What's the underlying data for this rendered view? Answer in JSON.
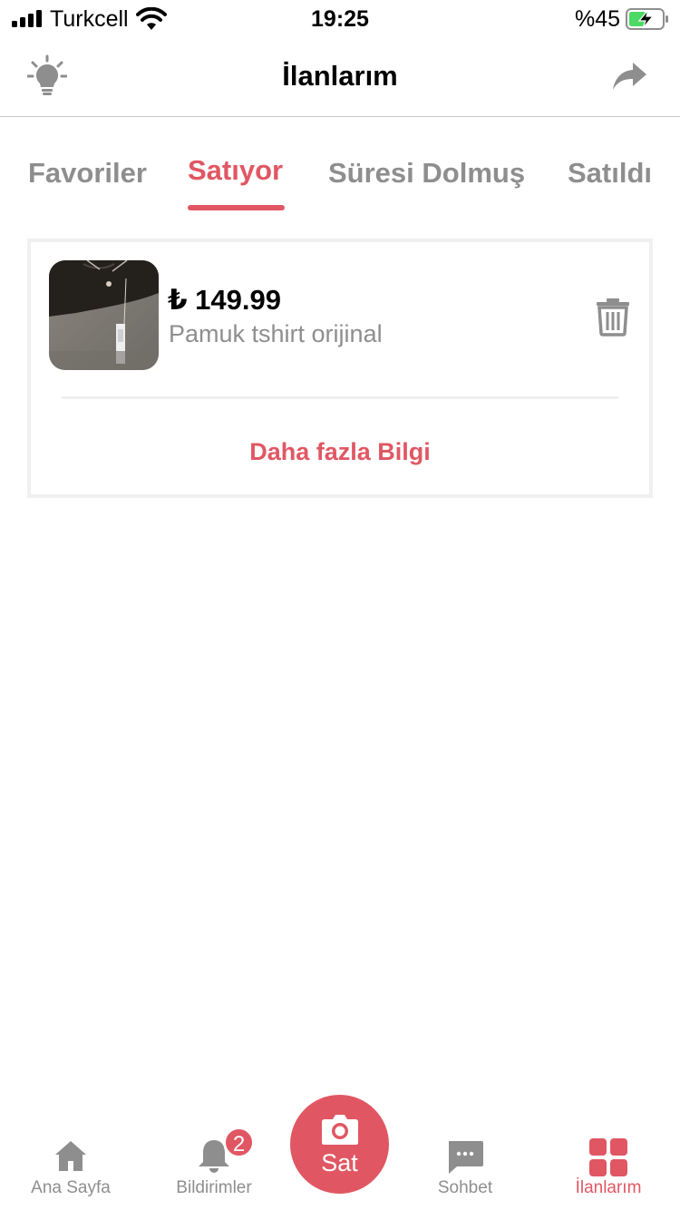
{
  "status_bar": {
    "carrier": "Turkcell",
    "time": "19:25",
    "battery_percent": "%45",
    "battery_level": 0.45
  },
  "header": {
    "title": "İlanlarım",
    "left_icon": "lightbulb-icon",
    "right_icon": "share-icon"
  },
  "tabs": [
    {
      "label": "Favoriler",
      "active": false
    },
    {
      "label": "Satıyor",
      "active": true
    },
    {
      "label": "Süresi Dolmuş",
      "active": false
    },
    {
      "label": "Satıldı",
      "active": false
    }
  ],
  "listing": {
    "price": "₺ 149.99",
    "title": "Pamuk tshirt orijinal",
    "more_info": "Daha fazla Bilgi",
    "delete_icon": "trash-icon"
  },
  "bottom_nav": {
    "items": [
      {
        "label": "Ana Sayfa",
        "icon": "home-icon",
        "active": false
      },
      {
        "label": "Bildirimler",
        "icon": "bell-icon",
        "active": false,
        "badge": "2"
      },
      {
        "label": "Sat",
        "icon": "camera-icon",
        "active": false
      },
      {
        "label": "Sohbet",
        "icon": "chat-icon",
        "active": false
      },
      {
        "label": "İlanlarım",
        "icon": "grid-icon",
        "active": true
      }
    ]
  },
  "colors": {
    "accent": "#e05763",
    "muted_text": "#8e8e8e",
    "divider": "#f0f0f0"
  }
}
